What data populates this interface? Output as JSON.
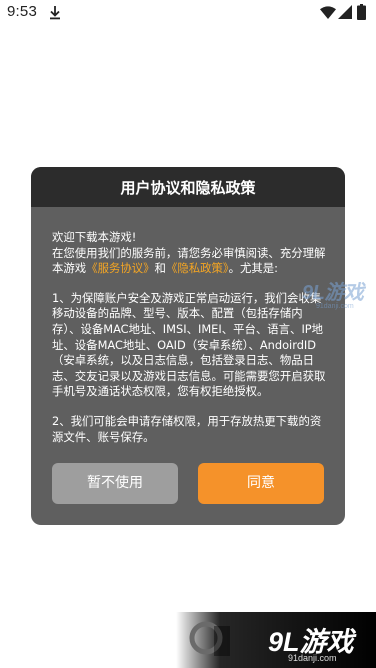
{
  "status_bar": {
    "time": "9:53",
    "icons": [
      "download-icon",
      "wifi-icon",
      "signal-icon",
      "battery-icon"
    ]
  },
  "dialog": {
    "title": "用户协议和隐私政策",
    "welcome": "欢迎下载本游戏!",
    "intro_a": "在您使用我们的服务前，请您务必审慎阅读、充分理解本游戏",
    "link_service": "《服务协议》",
    "intro_and": "和",
    "link_privacy": "《隐私政策》",
    "intro_b": "。尤其是:",
    "point_1": "1、为保障账户安全及游戏正常启动运行，我们会收集移动设备的品牌、型号、版本、配置（包括存储内存）、设备MAC地址、IMSI、IMEI、平台、语言、IP地址、设备MAC地址、OAID（安卓系统）、AndoirdID（安卓系统，以及日志信息，包括登录日志、物品日志、交友记录以及游戏日志信息。可能需要您开启获取手机号及通话状态权限，您有权拒绝授权。",
    "point_2": "2、我们可能会申请存储权限，用于存放热更下载的资源文件、账号保存。",
    "decline_label": "暂不使用",
    "agree_label": "同意",
    "link_color": "#f5a623"
  },
  "watermark": {
    "mid_brand": "9L游戏",
    "mid_url": "91danji.com",
    "bottom_brand": "9L游戏",
    "bottom_url": "91danji.com"
  }
}
